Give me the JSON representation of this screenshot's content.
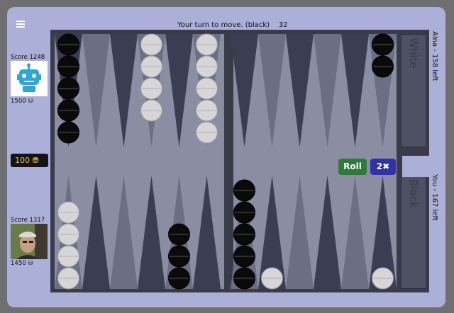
{
  "status": {
    "text": "Your turn to move. (black)",
    "pips": "32"
  },
  "opponent": {
    "score": "Score 1248",
    "coins": "1500",
    "name_left": "Alna - 158 left"
  },
  "player": {
    "score": "Score 1317",
    "coins": "1450",
    "name_left": "You - 167 left"
  },
  "stake": "100",
  "trays": {
    "top": "White",
    "bottom": "Black"
  },
  "buttons": {
    "roll": "Roll",
    "double": "2✖"
  },
  "colors": {
    "board_frame": "#393b4a",
    "board_field": "#8b8da3",
    "point_dark": "#3b3d52",
    "point_light": "#6c6e84",
    "accent_roll": "#2f7a3a",
    "accent_double": "#2e34a6"
  },
  "checkers": {
    "top": [
      {
        "point": 12,
        "color": "black",
        "count": 5
      },
      {
        "point": 9,
        "color": "white",
        "count": 4
      },
      {
        "point": 7,
        "color": "white",
        "count": 5
      },
      {
        "point": 1,
        "color": "black",
        "count": 2
      }
    ],
    "bottom": [
      {
        "point": 13,
        "color": "white",
        "count": 4
      },
      {
        "point": 17,
        "color": "black",
        "count": 3
      },
      {
        "point": 19,
        "color": "black",
        "count": 5
      },
      {
        "point": 20,
        "color": "white",
        "count": 1
      },
      {
        "point": 24,
        "color": "white",
        "count": 1
      }
    ]
  }
}
